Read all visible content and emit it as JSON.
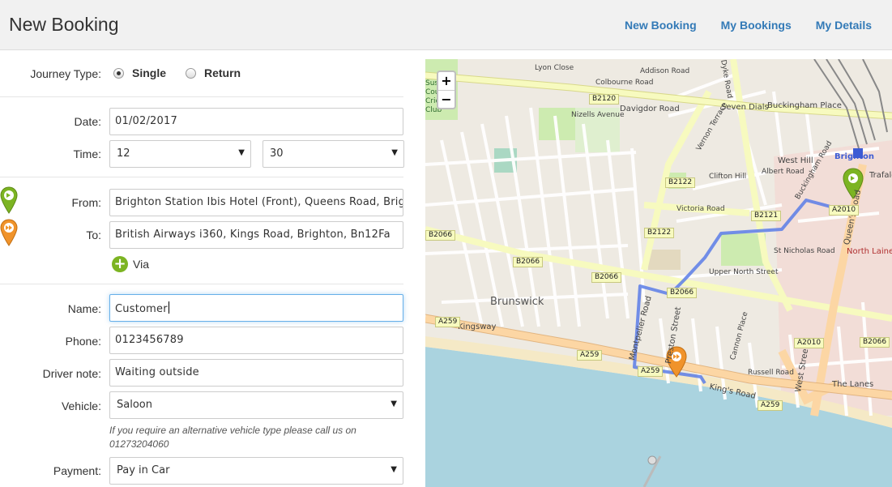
{
  "header": {
    "title": "New Booking",
    "nav": [
      "New Booking",
      "My Bookings",
      "My Details"
    ]
  },
  "form": {
    "journey_type_label": "Journey Type:",
    "journey_options": [
      "Single",
      "Return"
    ],
    "journey_selected": "Single",
    "date_label": "Date:",
    "date_value": "01/02/2017",
    "time_label": "Time:",
    "time_hour": "12",
    "time_minute": "30",
    "from_label": "From:",
    "from_value": "Brighton Station Ibis Hotel (Front), Queens Road, Brighton",
    "to_label": "To:",
    "to_value": "British Airways i360, Kings Road, Brighton, Bn12Fa",
    "via_label": "Via",
    "name_label": "Name:",
    "name_value": "Customer",
    "phone_label": "Phone:",
    "phone_value": "0123456789",
    "driver_note_label": "Driver note:",
    "driver_note_value": "Waiting outside",
    "vehicle_label": "Vehicle:",
    "vehicle_value": "Saloon",
    "vehicle_note": "If you require an alternative vehicle type please call us on 01273204060",
    "payment_label": "Payment:",
    "payment_value": "Pay in Car"
  },
  "map": {
    "zoom_in": "+",
    "zoom_out": "−",
    "labels": {
      "brunswick": "Brunswick",
      "brighton": "Brighton",
      "the_lanes": "The Lanes",
      "north_laine": "North Laine",
      "seven_dials": "Seven Dials",
      "buckingham_place": "Buckingham Place",
      "west_hill": "West Hill",
      "kingsway": "Kingsway",
      "kings_road": "King's Road",
      "queens_road": "Queen's Road",
      "dyke_road": "Dyke Road",
      "davigdor_road": "Davigdor Road",
      "vernon_terrace": "Vernon Terrace",
      "montpelier_road": "Montpelier Road",
      "preston_street": "Preston Street",
      "upper_north_street": "Upper North Street",
      "west_street": "West Street",
      "sussex_cricket": "Sussex County Cricket Club",
      "lyon_close": "Lyon Close",
      "addison_road": "Addison Road",
      "colbourne_road": "Colbourne Road",
      "nizells_avenue": "Nizells Avenue",
      "clifton_hill": "Clifton Hill",
      "victoria_road": "Victoria Road",
      "russell_road": "Russell Road",
      "cannon_place": "Cannon Place",
      "st_nicholas_road": "St Nicholas Road",
      "buckingham_road": "Buckingham Road",
      "albert_road": "Albert Road",
      "trafalgar": "Trafalg"
    },
    "road_refs": {
      "b2120": "B2120",
      "b2122_a": "B2122",
      "b2122_b": "B2122",
      "b2066_a": "B2066",
      "b2066_b": "B2066",
      "b2066_c": "B2066",
      "b2066_d": "B2066",
      "b2066_e": "B2066",
      "b2121": "B2121",
      "a2010_a": "A2010",
      "a2010_b": "A2010",
      "a259_a": "A259",
      "a259_b": "A259",
      "a259_c": "A259",
      "a259_d": "A259"
    },
    "colors": {
      "land": "#f2efe9",
      "sea": "#aad3df",
      "beach": "#f5e9c6",
      "park": "#cdebb0",
      "primary_road": "#fcd6a4",
      "secondary_road": "#f7fabf",
      "route": "#5b7de8",
      "from_pin": "#7cb422",
      "to_pin": "#f0932b"
    }
  }
}
